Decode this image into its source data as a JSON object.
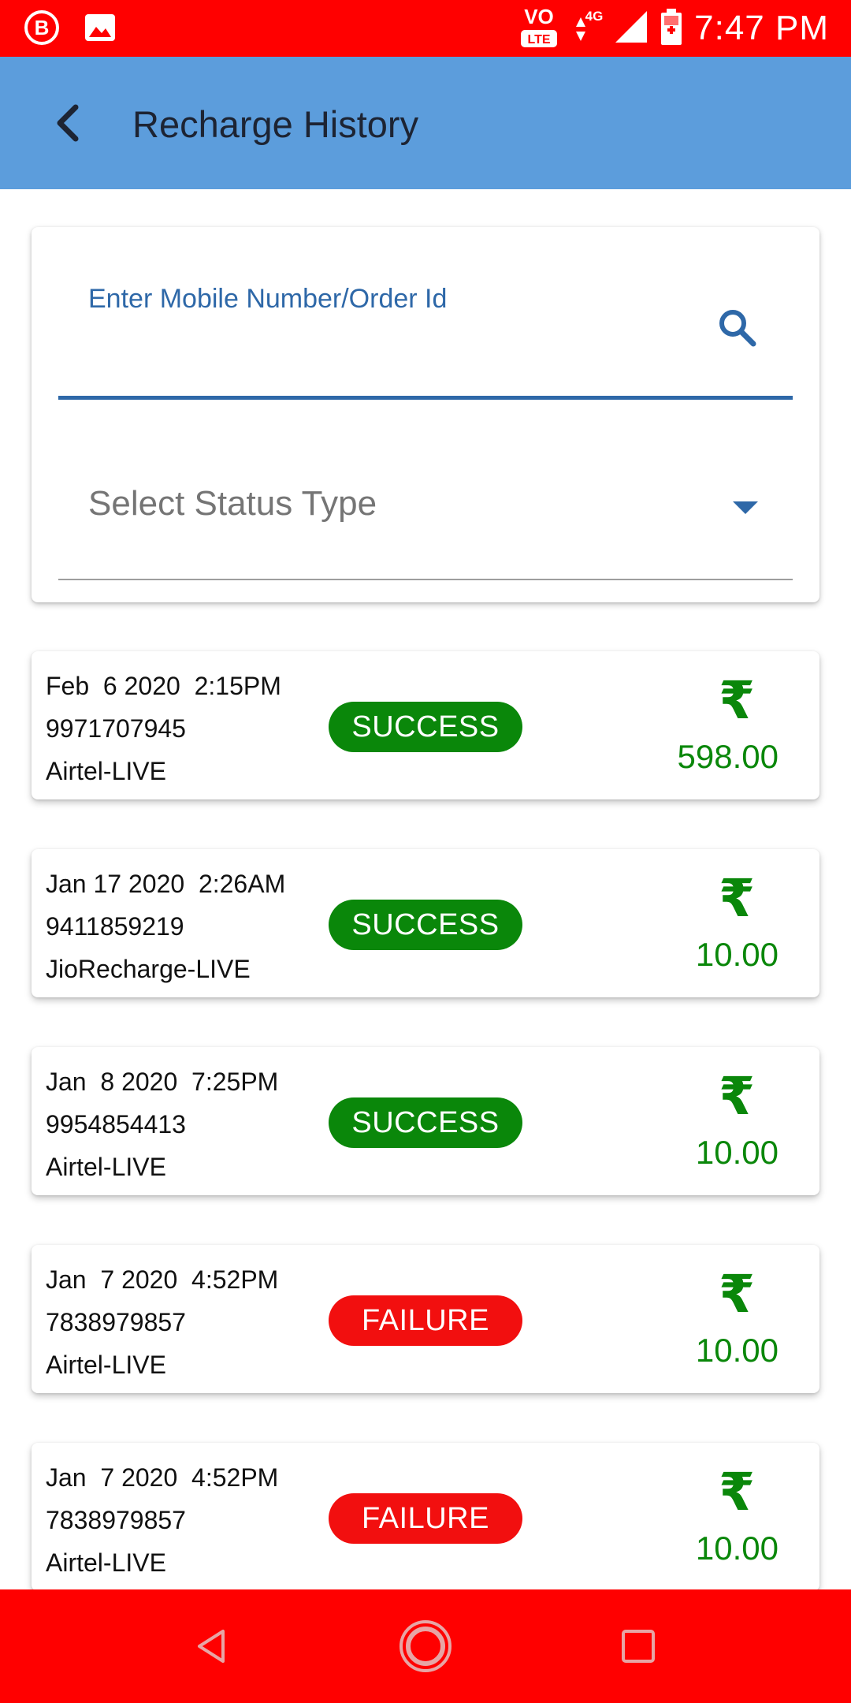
{
  "status_bar": {
    "time": "7:47 PM",
    "icons": [
      "b-notification-icon",
      "image-notification-icon",
      "volte-icon",
      "4g-icon",
      "signal-icon",
      "battery-charging-icon"
    ]
  },
  "app_bar": {
    "title": "Recharge History",
    "back_icon": "back-arrow-icon"
  },
  "filter": {
    "search_label": "Enter Mobile Number/Order Id",
    "search_value": "",
    "search_icon": "search-icon",
    "status_placeholder": "Select Status Type",
    "dropdown_icon": "dropdown-triangle-icon"
  },
  "transactions": [
    {
      "date": "Feb  6 2020  2:15PM",
      "number": "9971707945",
      "operator": "Airtel-LIVE",
      "status": "SUCCESS",
      "currency": "₹",
      "amount": "598.00"
    },
    {
      "date": "Jan 17 2020  2:26AM",
      "number": "9411859219",
      "operator": "JioRecharge-LIVE",
      "status": "SUCCESS",
      "currency": "₹",
      "amount": "10.00"
    },
    {
      "date": "Jan  8 2020  7:25PM",
      "number": "9954854413",
      "operator": "Airtel-LIVE",
      "status": "SUCCESS",
      "currency": "₹",
      "amount": "10.00"
    },
    {
      "date": "Jan  7 2020  4:52PM",
      "number": "7838979857",
      "operator": "Airtel-LIVE",
      "status": "FAILURE",
      "currency": "₹",
      "amount": "10.00"
    },
    {
      "date": "Jan  7 2020  4:52PM",
      "number": "7838979857",
      "operator": "Airtel-LIVE",
      "status": "FAILURE",
      "currency": "₹",
      "amount": "10.00"
    }
  ],
  "colors": {
    "status_bar": "#ff0000",
    "app_bar": "#5c9ddc",
    "accent": "#2e68a8",
    "success": "#0a870a",
    "failure": "#f20f0f",
    "nav_bar": "#ff0000"
  },
  "nav_bar": {
    "icons": [
      "nav-back-icon",
      "nav-home-icon",
      "nav-recents-icon"
    ]
  }
}
